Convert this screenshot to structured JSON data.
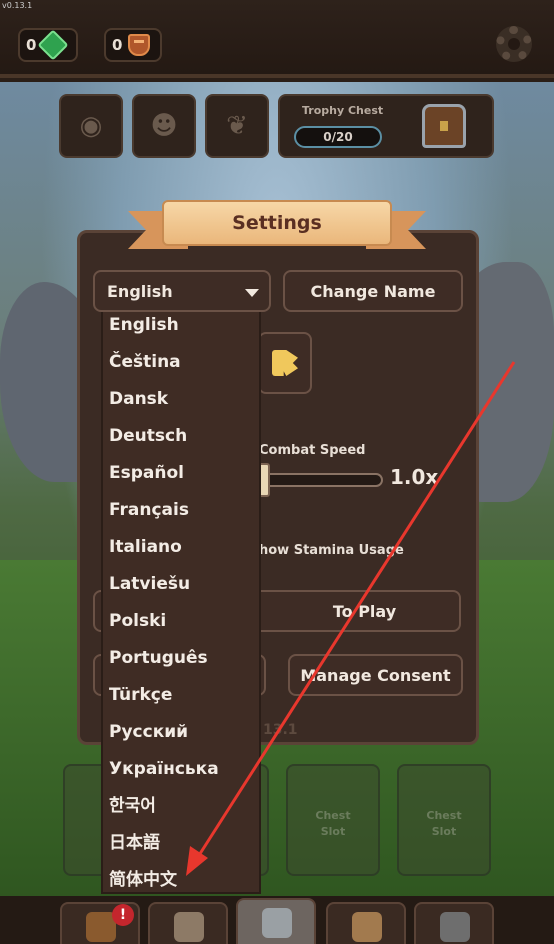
{
  "version": "v0.13.1",
  "currency": {
    "gems": "0",
    "crowns": "0"
  },
  "social": [
    "discord-icon",
    "reddit-icon",
    "feather-icon"
  ],
  "trophy": {
    "title": "Trophy Chest",
    "progress": "0/20"
  },
  "settings": {
    "title": "Settings",
    "language_selected": "English",
    "change_name": "Change Name",
    "combat_speed_label": "Combat Speed",
    "combat_speed_value": "1.0x",
    "stamina_label": "how Stamina Usage",
    "play_label": "To Play",
    "manage_consent": "Manage Consent",
    "version_partial": "13.1"
  },
  "languages": [
    "English",
    "Čeština",
    "Dansk",
    "Deutsch",
    "Español",
    "Français",
    "Italiano",
    "Latviešu",
    "Polski",
    "Português",
    "Türkçe",
    "Русский",
    "Українська",
    "한국어",
    "日本語",
    "简体中文"
  ],
  "chest_slots": [
    {
      "line1": "C",
      "line2": ""
    },
    {
      "line1": "",
      "line2": ""
    },
    {
      "line1": "Chest",
      "line2": "Slot"
    },
    {
      "line1": "Chest",
      "line2": "Slot"
    }
  ],
  "nav": {
    "badge": "!"
  },
  "colors": {
    "accent": "#e8372d",
    "panel": "#3b2b24",
    "banner": "#f2c690"
  }
}
